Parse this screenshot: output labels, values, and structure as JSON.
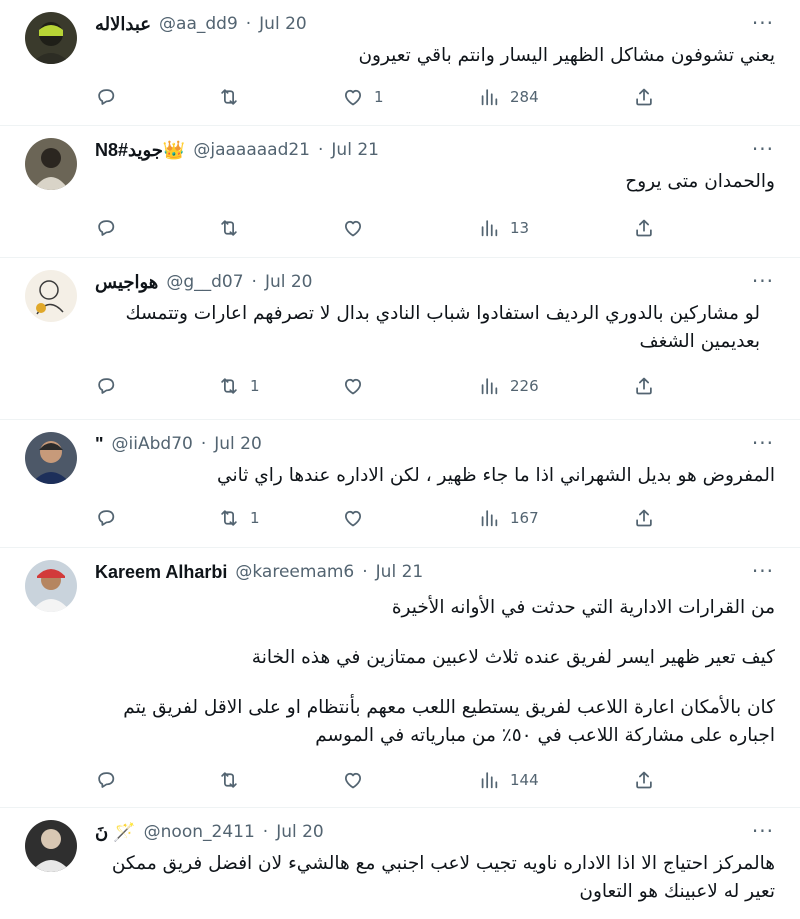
{
  "tweets": [
    {
      "name": "عبدالاله",
      "handle": "@aa_dd9",
      "date": "Jul 20",
      "text": [
        "يعني تشوفون مشاكل الظهير اليسار وانتم باقي تعيرون"
      ],
      "replies": "",
      "retweets": "",
      "likes": "1",
      "views": "284"
    },
    {
      "name": "N8#جويد",
      "name_emoji": "👑",
      "handle": "@jaaaaaad21",
      "date": "Jul 21",
      "text": [
        "والحمدان متى يروح"
      ],
      "replies": "",
      "retweets": "",
      "likes": "",
      "views": "13"
    },
    {
      "name": "هواجيس",
      "handle": "@g__d07",
      "date": "Jul 20",
      "text": [
        "لو مشاركين بالدوري الرديف استفادوا شباب النادي بدال لا تصرفهم اعارات وتتمسك بعديمين الشغف"
      ],
      "replies": "",
      "retweets": "1",
      "likes": "",
      "views": "226"
    },
    {
      "name": "\"",
      "handle": "@iiAbd70",
      "date": "Jul 20",
      "text": [
        "المفروض هو بديل الشهراني اذا ما جاء ظهير ، لكن الاداره عندها راي ثاني"
      ],
      "replies": "",
      "retweets": "1",
      "likes": "",
      "views": "167"
    },
    {
      "name": "Kareem Alharbi",
      "handle": "@kareemam6",
      "date": "Jul 21",
      "text": [
        "من القرارات الادارية التي حدثت في الأوانه الأخيرة",
        "",
        "كيف تعير ظهير ايسر لفريق عنده ثلاث لاعبين ممتازين في هذه الخانة",
        "",
        "كان بالأمكان اعارة اللاعب لفريق يستطيع اللعب معهم بأنتظام او على الاقل لفريق يتم اجباره على مشاركة اللاعب في ٥٠٪ من مبارياته في الموسم"
      ],
      "replies": "",
      "retweets": "",
      "likes": "",
      "views": "144"
    },
    {
      "name": "نَ",
      "name_emoji": "🪄",
      "handle": "@noon_2411",
      "date": "Jul 20",
      "text": [
        "هالمركز احتياج الا اذا الاداره ناويه تجيب لاعب اجنبي مع هالشيء لان افضل فريق ممكن تعير له لاعبينك هو التعاون"
      ],
      "replies": "",
      "retweets": "",
      "likes": "",
      "views": ""
    }
  ],
  "ui": {
    "dot": "·",
    "more": "···"
  },
  "colors": {
    "text": "#0f1419",
    "muted": "#536471",
    "divider": "#eff3f4"
  },
  "icons": {
    "reply": "reply-icon",
    "retweet": "retweet-icon",
    "like": "like-icon",
    "views": "views-icon",
    "share": "share-icon"
  }
}
